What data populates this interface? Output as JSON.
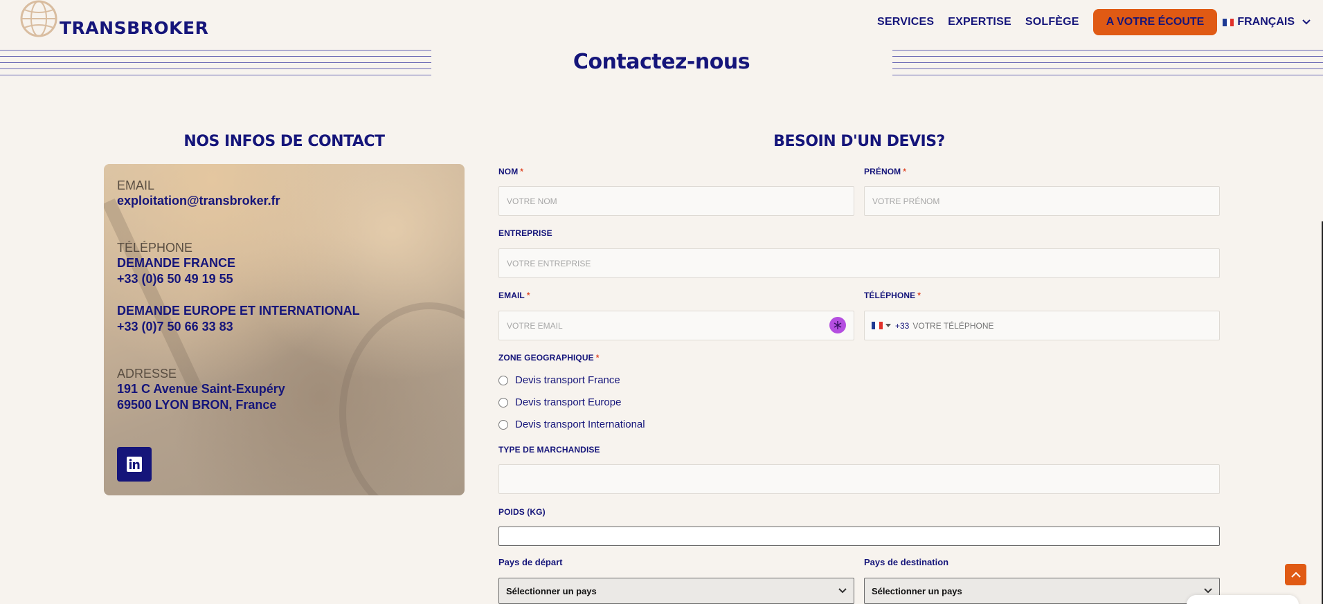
{
  "header": {
    "logo_text": "TRANSBROKER",
    "nav": [
      "SERVICES",
      "EXPERTISE",
      "SOLFÈGE"
    ],
    "cta": "A VOTRE ÉCOUTE",
    "language": "FRANÇAIS"
  },
  "page_title": "Contactez-nous",
  "contact": {
    "heading": "NOS INFOS DE CONTACT",
    "email_label": "EMAIL",
    "email_value": "exploitation@transbroker.fr",
    "phone_label": "TÉLÉPHONE",
    "phone_fr_label": "DEMANDE FRANCE",
    "phone_fr_value": "+33 (0)6 50 49 19 55",
    "phone_intl_label": "DEMANDE EUROPE ET INTERNATIONAL",
    "phone_intl_value": "+33 (0)7 50 66 33 83",
    "address_label": "ADRESSE",
    "address_line1": "191 C Avenue Saint-Exupéry",
    "address_line2": "69500 LYON BRON, France"
  },
  "form": {
    "heading": "BESOIN D'UN DEVIS?",
    "nom_label": "NOM",
    "nom_placeholder": "VOTRE NOM",
    "prenom_label": "PRÉNOM",
    "prenom_placeholder": "VOTRE PRÉNOM",
    "entreprise_label": "ENTREPRISE",
    "entreprise_placeholder": "VOTRE ENTREPRISE",
    "email_label": "EMAIL",
    "email_placeholder": "VOTRE EMAIL",
    "telephone_label": "TÉLÉPHONE",
    "telephone_code": "+33",
    "telephone_placeholder": "VOTRE TÉLÉPHONE",
    "zone_label": "ZONE GEOGRAPHIQUE",
    "zones": [
      "Devis transport France",
      "Devis transport Europe",
      "Devis transport International"
    ],
    "marchandise_label": "TYPE DE MARCHANDISE",
    "poids_label": "POIDS (KG)",
    "depart_label": "Pays de départ",
    "depart_value": "Sélectionner un pays",
    "destination_label": "Pays de destination",
    "destination_value": "Sélectionner un pays",
    "required_mark": "*"
  },
  "colors": {
    "navy": "#15157a",
    "orange": "#e05a14",
    "background": "#f7f3ee"
  }
}
